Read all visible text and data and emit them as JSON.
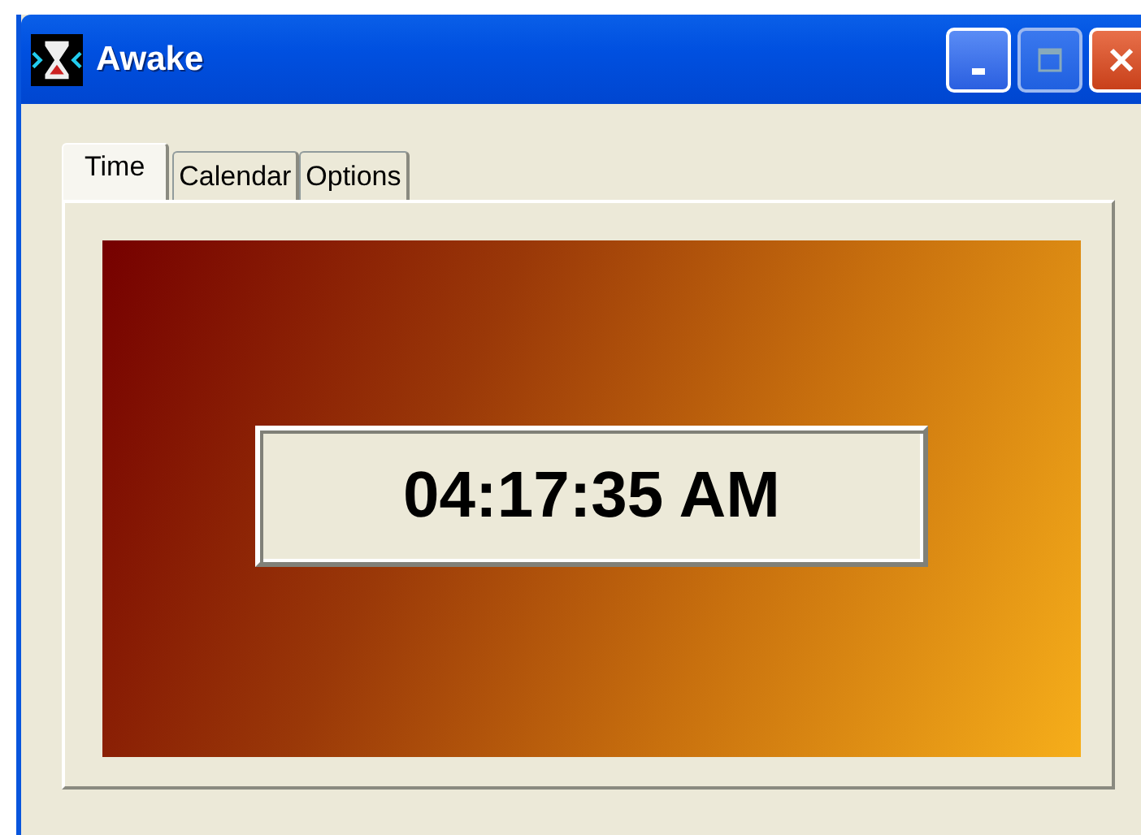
{
  "window": {
    "title": "Awake"
  },
  "tabs": [
    {
      "label": "Time",
      "selected": true
    },
    {
      "label": "Calendar",
      "selected": false
    },
    {
      "label": "Options",
      "selected": false
    }
  ],
  "clock": {
    "time": "04:17:35 AM"
  }
}
